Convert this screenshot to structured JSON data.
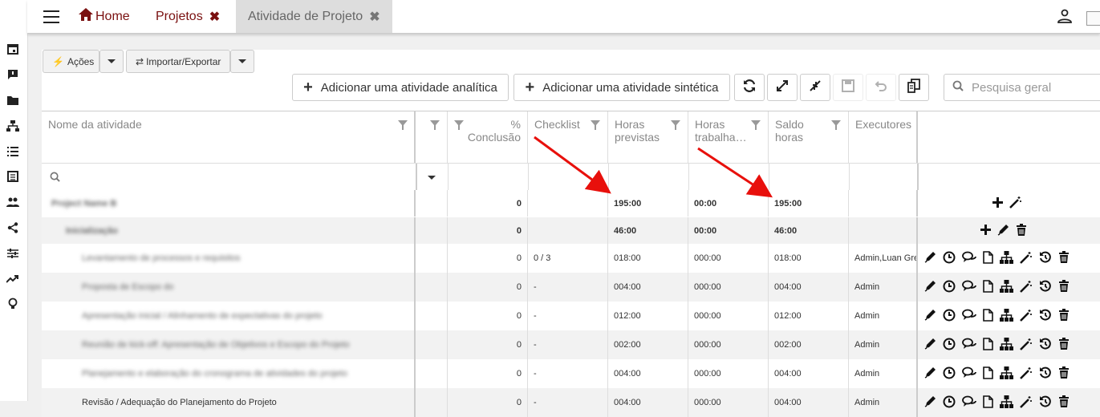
{
  "tabs": [
    {
      "label": "Home"
    },
    {
      "label": "Projetos"
    },
    {
      "label": "Atividade de Projeto"
    }
  ],
  "toolbar": {
    "acoes_label": "Ações",
    "importar_label": "Importar/Exportar",
    "add_analitica_label": "Adicionar uma atividade analítica",
    "add_sintetica_label": "Adicionar uma atividade sintética",
    "search_placeholder": "Pesquisa geral"
  },
  "columns": {
    "nome": "Nome da atividade",
    "conclusao_pct": "%",
    "conclusao": "Conclusão",
    "checklist": "Checklist",
    "horas_previstas_1": "Horas",
    "horas_previstas_2": "previstas",
    "horas_trab_1": "Horas",
    "horas_trab_2": "trabalha…",
    "saldo_1": "Saldo",
    "saldo_2": "horas",
    "executores": "Executores"
  },
  "rows": [
    {
      "name": "Project Name B",
      "conclusao": "0",
      "checklist": "",
      "previstas": "195:00",
      "trabalhadas": "00:00",
      "saldo": "195:00",
      "executores": ""
    },
    {
      "name": "Inicialização",
      "conclusao": "0",
      "checklist": "",
      "previstas": "46:00",
      "trabalhadas": "00:00",
      "saldo": "46:00",
      "executores": ""
    },
    {
      "name": "Levantamento de processos e requisitos",
      "conclusao": "0",
      "checklist": "0 / 3",
      "previstas": "018:00",
      "trabalhadas": "000:00",
      "saldo": "018:00",
      "executores": "Admin,Luan Gre"
    },
    {
      "name": "Proposta de Escopo do",
      "conclusao": "0",
      "checklist": "-",
      "previstas": "004:00",
      "trabalhadas": "000:00",
      "saldo": "004:00",
      "executores": "Admin"
    },
    {
      "name": "Apresentação inicial / Alinhamento de expectativas do projeto",
      "conclusao": "0",
      "checklist": "-",
      "previstas": "012:00",
      "trabalhadas": "000:00",
      "saldo": "012:00",
      "executores": "Admin"
    },
    {
      "name": "Reunião de kick-off: Apresentação de Objetivos e Escopo do Projeto",
      "conclusao": "0",
      "checklist": "-",
      "previstas": "002:00",
      "trabalhadas": "000:00",
      "saldo": "002:00",
      "executores": "Admin"
    },
    {
      "name": "Planejamento e elaboração do cronograma de atividades do projeto",
      "conclusao": "0",
      "checklist": "-",
      "previstas": "004:00",
      "trabalhadas": "000:00",
      "saldo": "004:00",
      "executores": "Admin"
    },
    {
      "name": "Revisão / Adequação do Planejamento do Projeto",
      "conclusao": "0",
      "checklist": "-",
      "previstas": "004:00",
      "trabalhadas": "000:00",
      "saldo": "004:00",
      "executores": "Admin"
    }
  ],
  "colors": {
    "brand": "#7a1010",
    "arrow": "#e8100c"
  }
}
